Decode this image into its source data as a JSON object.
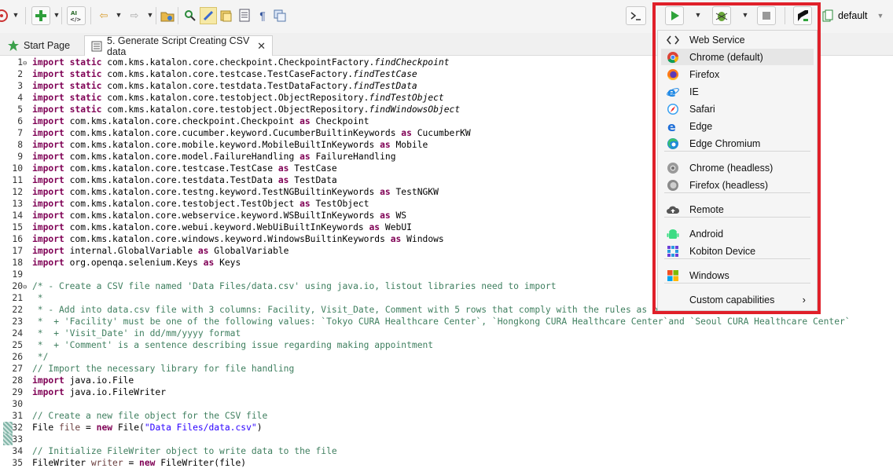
{
  "toolbar": {
    "items": [
      "profile-icon",
      "new-button",
      "keyword-script-button",
      "back-button",
      "forward-button",
      "open-folder-button",
      "spy-button",
      "record-button",
      "object-repo-button",
      "show-whitespace-button",
      "pilcrow-button",
      "terminal-button"
    ],
    "run_default_profile_label": "default"
  },
  "tabs": [
    {
      "label": "Start Page"
    },
    {
      "label": "5. Generate Script Creating CSV data",
      "close": "✕"
    }
  ],
  "editor": {
    "fold_marker": "⊖",
    "lines": [
      {
        "n": "1",
        "parts": [
          [
            "kw",
            "import"
          ],
          [
            "kw",
            " static"
          ],
          [
            "code",
            " com.kms.katalon.core.checkpoint.CheckpointFactory."
          ],
          [
            "it",
            "findCheckpoint"
          ]
        ]
      },
      {
        "n": "2",
        "parts": [
          [
            "kw",
            "import"
          ],
          [
            "kw",
            " static"
          ],
          [
            "code",
            " com.kms.katalon.core.testcase.TestCaseFactory."
          ],
          [
            "it",
            "findTestCase"
          ]
        ]
      },
      {
        "n": "3",
        "parts": [
          [
            "kw",
            "import"
          ],
          [
            "kw",
            " static"
          ],
          [
            "code",
            " com.kms.katalon.core.testdata.TestDataFactory."
          ],
          [
            "it",
            "findTestData"
          ]
        ]
      },
      {
        "n": "4",
        "parts": [
          [
            "kw",
            "import"
          ],
          [
            "kw",
            " static"
          ],
          [
            "code",
            " com.kms.katalon.core.testobject.ObjectRepository."
          ],
          [
            "it",
            "findTestObject"
          ]
        ]
      },
      {
        "n": "5",
        "parts": [
          [
            "kw",
            "import"
          ],
          [
            "kw",
            " static"
          ],
          [
            "code",
            " com.kms.katalon.core.testobject.ObjectRepository."
          ],
          [
            "it",
            "findWindowsObject"
          ]
        ]
      },
      {
        "n": "6",
        "parts": [
          [
            "kw",
            "import"
          ],
          [
            "code",
            " com.kms.katalon.core.checkpoint.Checkpoint "
          ],
          [
            "kw",
            "as"
          ],
          [
            "code",
            " Checkpoint"
          ]
        ]
      },
      {
        "n": "7",
        "parts": [
          [
            "kw",
            "import"
          ],
          [
            "code",
            " com.kms.katalon.core.cucumber.keyword.CucumberBuiltinKeywords "
          ],
          [
            "kw",
            "as"
          ],
          [
            "code",
            " CucumberKW"
          ]
        ]
      },
      {
        "n": "8",
        "parts": [
          [
            "kw",
            "import"
          ],
          [
            "code",
            " com.kms.katalon.core.mobile.keyword.MobileBuiltInKeywords "
          ],
          [
            "kw",
            "as"
          ],
          [
            "code",
            " Mobile"
          ]
        ]
      },
      {
        "n": "9",
        "parts": [
          [
            "kw",
            "import"
          ],
          [
            "code",
            " com.kms.katalon.core.model.FailureHandling "
          ],
          [
            "kw",
            "as"
          ],
          [
            "code",
            " FailureHandling"
          ]
        ]
      },
      {
        "n": "10",
        "parts": [
          [
            "kw",
            "import"
          ],
          [
            "code",
            " com.kms.katalon.core.testcase.TestCase "
          ],
          [
            "kw",
            "as"
          ],
          [
            "code",
            " TestCase"
          ]
        ]
      },
      {
        "n": "11",
        "parts": [
          [
            "kw",
            "import"
          ],
          [
            "code",
            " com.kms.katalon.core.testdata.TestData "
          ],
          [
            "kw",
            "as"
          ],
          [
            "code",
            " TestData"
          ]
        ]
      },
      {
        "n": "12",
        "parts": [
          [
            "kw",
            "import"
          ],
          [
            "code",
            " com.kms.katalon.core.testng.keyword.TestNGBuiltinKeywords "
          ],
          [
            "kw",
            "as"
          ],
          [
            "code",
            " TestNGKW"
          ]
        ]
      },
      {
        "n": "13",
        "parts": [
          [
            "kw",
            "import"
          ],
          [
            "code",
            " com.kms.katalon.core.testobject.TestObject "
          ],
          [
            "kw",
            "as"
          ],
          [
            "code",
            " TestObject"
          ]
        ]
      },
      {
        "n": "14",
        "parts": [
          [
            "kw",
            "import"
          ],
          [
            "code",
            " com.kms.katalon.core.webservice.keyword.WSBuiltInKeywords "
          ],
          [
            "kw",
            "as"
          ],
          [
            "code",
            " WS"
          ]
        ]
      },
      {
        "n": "15",
        "parts": [
          [
            "kw",
            "import"
          ],
          [
            "code",
            " com.kms.katalon.core.webui.keyword.WebUiBuiltInKeywords "
          ],
          [
            "kw",
            "as"
          ],
          [
            "code",
            " WebUI"
          ]
        ]
      },
      {
        "n": "16",
        "parts": [
          [
            "kw",
            "import"
          ],
          [
            "code",
            " com.kms.katalon.core.windows.keyword.WindowsBuiltinKeywords "
          ],
          [
            "kw",
            "as"
          ],
          [
            "code",
            " Windows"
          ]
        ]
      },
      {
        "n": "17",
        "parts": [
          [
            "kw",
            "import"
          ],
          [
            "code",
            " internal.GlobalVariable "
          ],
          [
            "kw",
            "as"
          ],
          [
            "code",
            " GlobalVariable"
          ]
        ]
      },
      {
        "n": "18",
        "parts": [
          [
            "kw",
            "import"
          ],
          [
            "code",
            " org.openqa.selenium.Keys "
          ],
          [
            "kw",
            "as"
          ],
          [
            "code",
            " Keys"
          ]
        ]
      },
      {
        "n": "19",
        "parts": []
      },
      {
        "n": "20",
        "parts": [
          [
            "cm",
            "/* - Create a CSV file named 'Data Files/data.csv' using java.io, listout libraries need to import"
          ]
        ]
      },
      {
        "n": "21",
        "parts": [
          [
            "cm",
            " *"
          ]
        ]
      },
      {
        "n": "22",
        "parts": [
          [
            "cm",
            " * - Add into data.csv file with 3 columns: Facility, Visit_Date, Comment with 5 rows that comply with the rules as below:"
          ]
        ]
      },
      {
        "n": "23",
        "parts": [
          [
            "cm",
            " *  + 'Facility' must be one of the following values: `Tokyo CURA Healthcare Center`, `Hongkong CURA Healthcare Center`and `Seoul CURA Healthcare Center`"
          ]
        ]
      },
      {
        "n": "24",
        "parts": [
          [
            "cm",
            " *  + 'Visit_Date' in dd/mm/yyyy format"
          ]
        ]
      },
      {
        "n": "25",
        "parts": [
          [
            "cm",
            " *  + 'Comment' is a sentence describing issue regarding making appointment"
          ]
        ]
      },
      {
        "n": "26",
        "parts": [
          [
            "cm",
            " */"
          ]
        ]
      },
      {
        "n": "27",
        "parts": [
          [
            "cm",
            "// Import the necessary library for file handling"
          ]
        ]
      },
      {
        "n": "28",
        "parts": [
          [
            "kw",
            "import"
          ],
          [
            "code",
            " java.io.File"
          ]
        ]
      },
      {
        "n": "29",
        "parts": [
          [
            "kw",
            "import"
          ],
          [
            "code",
            " java.io.FileWriter"
          ]
        ]
      },
      {
        "n": "30",
        "parts": []
      },
      {
        "n": "31",
        "parts": [
          [
            "cm",
            "// Create a new file object for the CSV file"
          ]
        ]
      },
      {
        "n": "32",
        "parts": [
          [
            "code",
            "File "
          ],
          [
            "var",
            "file"
          ],
          [
            "code",
            " = "
          ],
          [
            "kw",
            "new"
          ],
          [
            "code",
            " File("
          ],
          [
            "str",
            "\"Data Files/data.csv\""
          ],
          [
            "code",
            ")"
          ]
        ]
      },
      {
        "n": "33",
        "parts": []
      },
      {
        "n": "34",
        "parts": [
          [
            "cm",
            "// Initialize FileWriter object to write data to the file"
          ]
        ]
      },
      {
        "n": "35",
        "parts": [
          [
            "code",
            "FileWriter "
          ],
          [
            "var",
            "writer"
          ],
          [
            "code",
            " = "
          ],
          [
            "kw",
            "new"
          ],
          [
            "code",
            " FileWriter(file)"
          ]
        ]
      }
    ]
  },
  "run_menu": {
    "items": [
      {
        "label": "Web Service",
        "icon": "web-service-icon"
      },
      {
        "label": "Chrome (default)",
        "icon": "chrome-icon",
        "highlighted": true
      },
      {
        "label": "Firefox",
        "icon": "firefox-icon"
      },
      {
        "label": "IE",
        "icon": "ie-icon"
      },
      {
        "label": "Safari",
        "icon": "safari-icon"
      },
      {
        "label": "Edge",
        "icon": "edge-icon"
      },
      {
        "label": "Edge Chromium",
        "icon": "edge-chromium-icon"
      },
      {
        "label": "Chrome (headless)",
        "icon": "chrome-headless-icon"
      },
      {
        "label": "Firefox (headless)",
        "icon": "firefox-headless-icon"
      },
      {
        "label": "Remote",
        "icon": "remote-icon"
      },
      {
        "label": "Android",
        "icon": "android-icon"
      },
      {
        "label": "Kobiton Device",
        "icon": "kobiton-icon"
      },
      {
        "label": "Windows",
        "icon": "windows-icon"
      },
      {
        "label": "Custom capabilities",
        "icon": "",
        "submenu_arrow": "›"
      }
    ]
  },
  "colors": {
    "highlight_border": "#e0202a",
    "keyword": "#7f0055",
    "comment": "#3f7f5f",
    "string": "#2a00ff"
  }
}
